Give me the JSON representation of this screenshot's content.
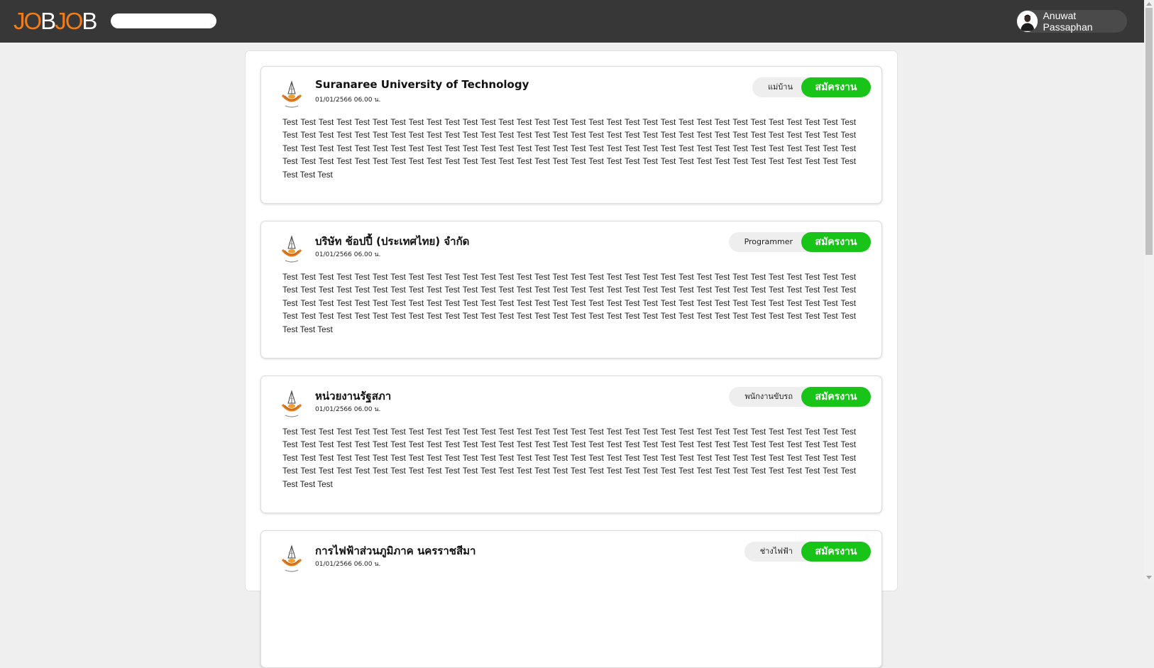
{
  "header": {
    "logo": {
      "part1": "JO",
      "part2": "B",
      "part3": "JO",
      "part4": "B"
    },
    "search": {
      "value": "",
      "placeholder": ""
    },
    "user": {
      "name": "Anuwat Passaphan"
    }
  },
  "apply_label": "สมัครงาน",
  "posts": [
    {
      "company": "Suranaree University of Technology",
      "date": "01/01/2566 06.00 น.",
      "position": "แม่บ้าน",
      "description": "Test Test Test Test Test Test Test Test Test Test Test Test Test Test Test Test Test Test Test Test Test Test Test Test Test Test Test Test Test Test Test Test Test Test Test Test Test Test Test Test Test Test Test Test Test Test Test Test Test Test Test Test Test Test Test Test Test Test Test Test Test Test Test Test Test Test Test Test Test Test Test Test Test Test Test Test Test Test Test Test Test Test Test Test Test Test Test Test Test Test Test Test Test Test Test Test Test Test Test Test Test Test Test Test Test Test Test Test Test Test Test Test Test Test Test Test Test Test Test Test Test Test Test Test Test Test Test Test Test Test Test"
    },
    {
      "company": "บริษัท ช้อปปี้ (ประเทศไทย) จำกัด",
      "date": "01/01/2566 06.00 น.",
      "position": "Programmer",
      "description": "Test Test Test Test Test Test Test Test Test Test Test Test Test Test Test Test Test Test Test Test Test Test Test Test Test Test Test Test Test Test Test Test Test Test Test Test Test Test Test Test Test Test Test Test Test Test Test Test Test Test Test Test Test Test Test Test Test Test Test Test Test Test Test Test Test Test Test Test Test Test Test Test Test Test Test Test Test Test Test Test Test Test Test Test Test Test Test Test Test Test Test Test Test Test Test Test Test Test Test Test Test Test Test Test Test Test Test Test Test Test Test Test Test Test Test Test Test Test Test Test Test Test Test Test Test Test Test Test Test Test Test"
    },
    {
      "company": "หน่วยงานรัฐสภา",
      "date": "01/01/2566 06.00 น.",
      "position": "พนักงานขับรถ",
      "description": "Test Test Test Test Test Test Test Test Test Test Test Test Test Test Test Test Test Test Test Test Test Test Test Test Test Test Test Test Test Test Test Test Test Test Test Test Test Test Test Test Test Test Test Test Test Test Test Test Test Test Test Test Test Test Test Test Test Test Test Test Test Test Test Test Test Test Test Test Test Test Test Test Test Test Test Test Test Test Test Test Test Test Test Test Test Test Test Test Test Test Test Test Test Test Test Test Test Test Test Test Test Test Test Test Test Test Test Test Test Test Test Test Test Test Test Test Test Test Test Test Test Test Test Test Test Test Test Test Test Test Test"
    },
    {
      "company": "การไฟฟ้าส่วนภูมิภาค นครราชสีมา",
      "date": "01/01/2566 06.00 น.",
      "position": "ช่างไฟฟ้า",
      "description": ""
    }
  ]
}
